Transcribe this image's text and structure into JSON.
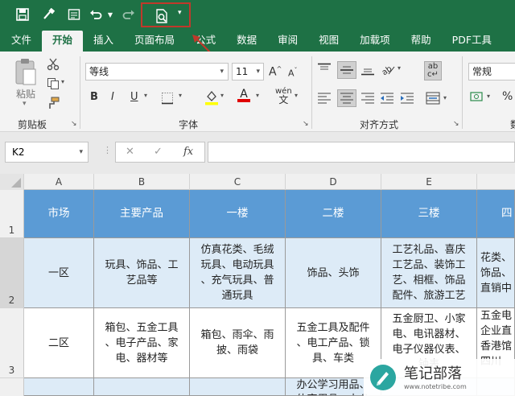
{
  "qat": {
    "items": [
      "save-icon",
      "format-painter-icon",
      "form-icon",
      "undo-icon",
      "undo-dropdown-icon",
      "redo-icon",
      "print-preview-icon",
      "customize-qat-icon"
    ]
  },
  "tabs": [
    "文件",
    "开始",
    "插入",
    "页面布局",
    "公式",
    "数据",
    "审阅",
    "视图",
    "加载项",
    "帮助",
    "PDF工具"
  ],
  "active_tab": "开始",
  "ribbon": {
    "clipboard": {
      "label": "剪贴板",
      "paste_label": "粘贴"
    },
    "font": {
      "label": "字体",
      "name": "等线",
      "size": "11",
      "grow": "A",
      "shrink": "A",
      "bold": "B",
      "italic": "I",
      "underline": "U",
      "font_color": "A",
      "phonetic": "wén"
    },
    "alignment": {
      "label": "对齐方式"
    },
    "number": {
      "format": "常规"
    }
  },
  "formula_bar": {
    "name_box": "K2",
    "cancel": "✕",
    "enter": "✓",
    "fx": "fx",
    "value": ""
  },
  "columns": [
    "A",
    "B",
    "C",
    "D",
    "E"
  ],
  "rows": [
    "1",
    "2",
    "3"
  ],
  "table": {
    "header": [
      "市场",
      "主要产品",
      "一楼",
      "二楼",
      "三楼",
      "四"
    ],
    "rows": [
      [
        "一区",
        "玩具、饰品、工\n艺品等",
        "仿真花类、毛绒\n玩具、电动玩具\n、充气玩具、普\n通玩具",
        "饰品、头饰",
        "工艺礼品、喜庆\n工艺品、装饰工\n艺、相框、饰品\n配件、旅游工艺",
        "花类、\n饰品、\n直销中"
      ],
      [
        "二区",
        "箱包、五金工具\n、电子产品、家\n电、器材等",
        "箱包、雨伞、雨\n披、雨袋",
        "五金工具及配件\n、电工产品、锁\n具、车类",
        "五金厨卫、小家\n电、电讯器材、\n电子仪器仪表、\n钟表",
        "五金电\n企业直\n香港馆\n四川"
      ],
      [
        "",
        "",
        "",
        "办公学习用品、\n体育用品、办公",
        "",
        ""
      ]
    ]
  },
  "watermark": {
    "text": "笔记部落",
    "url": "www.notetribe.com"
  }
}
